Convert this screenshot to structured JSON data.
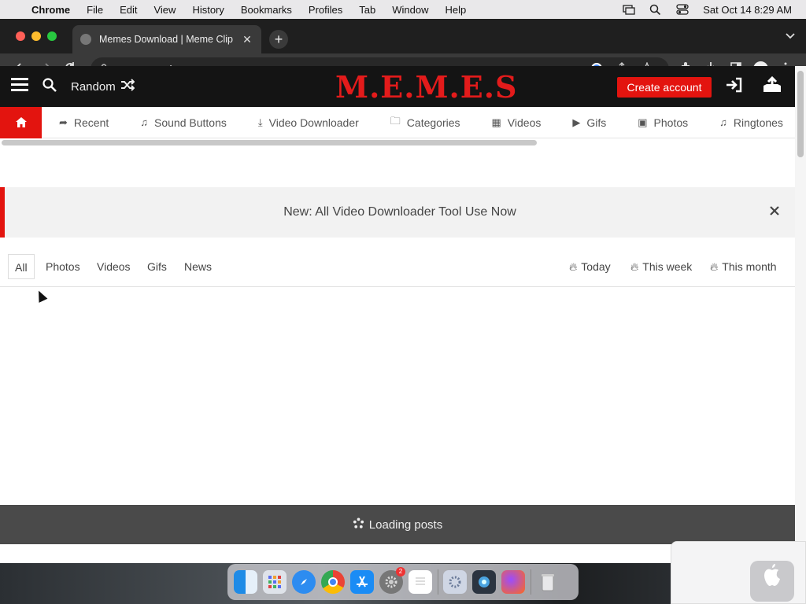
{
  "menubar": {
    "apple": "",
    "items": [
      "Chrome",
      "File",
      "Edit",
      "View",
      "History",
      "Bookmarks",
      "Profiles",
      "Tab",
      "Window",
      "Help"
    ],
    "clock": "Sat Oct 14  8:29 AM"
  },
  "browser": {
    "tab_title": "Memes Download | Meme Clip",
    "tab_close": "✕",
    "new_tab": "+",
    "url": "memes.co.in"
  },
  "site": {
    "random_label": "Random",
    "logo": "M.E.M.E.S",
    "create_account": "Create account",
    "categories": [
      {
        "label": "Recent",
        "icon": "share-icon",
        "glyph": "➦"
      },
      {
        "label": "Sound Buttons",
        "icon": "music-icon",
        "glyph": "♫"
      },
      {
        "label": "Video Downloader",
        "icon": "download-icon",
        "glyph": "⤓"
      },
      {
        "label": "Categories",
        "icon": "folder-icon",
        "glyph": "🗀"
      },
      {
        "label": "Videos",
        "icon": "film-icon",
        "glyph": "▦"
      },
      {
        "label": "Gifs",
        "icon": "play-icon",
        "glyph": "▶"
      },
      {
        "label": "Photos",
        "icon": "image-icon",
        "glyph": "▣"
      },
      {
        "label": "Ringtones",
        "icon": "music-icon",
        "glyph": "♫"
      }
    ],
    "notice": "New: All Video Downloader Tool Use Now",
    "filter_tabs": [
      "All",
      "Photos",
      "Videos",
      "Gifs",
      "News"
    ],
    "periods": [
      "Today",
      "This week",
      "This month"
    ],
    "loading": "Loading posts"
  },
  "colors": {
    "brand_red": "#e3140f",
    "header_bg": "#141414"
  }
}
